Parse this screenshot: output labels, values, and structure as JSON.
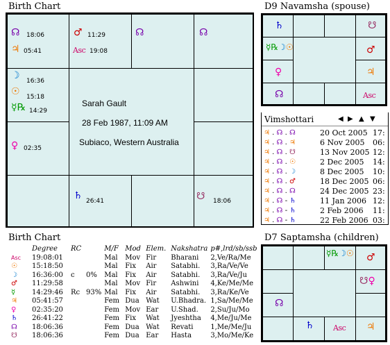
{
  "colors": {
    "mars": "#cc0000",
    "moon": "#0077cc",
    "venus": "#ee00aa",
    "mercury": "#009900",
    "jupiter": "#ee7700",
    "sun": "#ee7700",
    "saturn": "#0000cc",
    "rahu": "#7700aa",
    "ketu": "#993366",
    "asc": "#cc0066",
    "chart_fill": "#ddf0f0"
  },
  "birth_chart": {
    "title": "Birth Chart",
    "name": "Sarah Gault",
    "datetime": "28 Feb 1987,  11:09 AM",
    "place": "Subiaco, Western Australia",
    "houses": {
      "h12": [
        {
          "glyph": "☊",
          "deg": "18:06",
          "color": "rahu"
        },
        {
          "glyph": "♃",
          "deg": "05:41",
          "color": "jupiter"
        }
      ],
      "h1": [
        {
          "glyph": "♂",
          "deg": "11:29",
          "color": "mars"
        },
        {
          "glyph": "Asc",
          "deg": "19:08",
          "color": "asc"
        }
      ],
      "h11": [
        {
          "glyph": "☽",
          "deg": "16:36",
          "color": "moon"
        },
        {
          "glyph": "☉",
          "deg": "15:18",
          "color": "sun"
        },
        {
          "glyph": "☿℞",
          "deg": "14:29",
          "color": "mercury"
        }
      ],
      "h10": [
        {
          "glyph": "♀",
          "deg": "02:35",
          "color": "venus"
        }
      ],
      "h7": [
        {
          "glyph": "♄",
          "deg": "26:41",
          "color": "saturn"
        }
      ],
      "h6": [
        {
          "glyph": "☋",
          "deg": "18:06",
          "color": "ketu"
        }
      ],
      "h2": [
        {
          "glyph": "♉",
          "deg": "",
          "color": "rahu"
        }
      ]
    }
  },
  "d9": {
    "title": "D9 Navamsha  (spouse)",
    "houses": {
      "tl": [
        {
          "glyph": "♄",
          "color": "saturn"
        }
      ],
      "tr": [
        {
          "glyph": "☋",
          "color": "ketu"
        }
      ],
      "ml": [
        {
          "glyph": "☿℞☽☉",
          "color": "mercury"
        }
      ],
      "mr": [
        {
          "glyph": "♂",
          "color": "mars"
        }
      ],
      "l2": [
        {
          "glyph": "♀",
          "color": "venus"
        }
      ],
      "r2": [
        {
          "glyph": "♃",
          "color": "jupiter"
        }
      ],
      "bl": [
        {
          "glyph": "☊",
          "color": "rahu"
        }
      ],
      "br": [
        {
          "glyph": "Asc",
          "color": "asc"
        }
      ]
    }
  },
  "vimshottari": {
    "title": "Vimshottari",
    "rows": [
      {
        "glyphs": "♃ . ☊ . ☊",
        "date": "20 Oct 2005",
        "time": "17:"
      },
      {
        "glyphs": "♃ . ☊ . ♃",
        "date": "6 Nov 2005",
        "time": "06:"
      },
      {
        "glyphs": "♃ . ☊ . ☋",
        "date": "13 Nov 2005",
        "time": "12:"
      },
      {
        "glyphs": "♃ . ☊ . ☉",
        "date": "2 Dec 2005",
        "time": "14:"
      },
      {
        "glyphs": "♃ . ☊ . ☽",
        "date": "8 Dec 2005",
        "time": "10:"
      },
      {
        "glyphs": "♃ . ☊ . ♂",
        "date": "18 Dec 2005",
        "time": "06:"
      },
      {
        "glyphs": "♃ . ☊ . ☊",
        "date": "24 Dec 2005",
        "time": "23:"
      },
      {
        "glyphs": "♃ . ☊ - ♄",
        "date": "11 Jan 2006",
        "time": "12:"
      },
      {
        "glyphs": "♃ . ☊ - ♄",
        "date": "2 Feb 2006",
        "time": "11:"
      },
      {
        "glyphs": "♃ . ☊ - ♄",
        "date": "22 Feb 2006",
        "time": "03:"
      }
    ]
  },
  "d7": {
    "title": "D7 Saptamsha  (children)",
    "houses": {
      "tc": [
        {
          "glyph": "☿℞☽☉",
          "color": "mercury"
        }
      ],
      "tr": [
        {
          "glyph": "♂",
          "color": "mars"
        }
      ],
      "mr": [
        {
          "glyph": "☋♀",
          "color": "ketu"
        }
      ],
      "ml": [
        {
          "glyph": "☊",
          "color": "rahu"
        }
      ],
      "bc": [
        {
          "glyph": "♄",
          "color": "saturn"
        }
      ],
      "bc2": [
        {
          "glyph": "Asc",
          "color": "asc"
        }
      ],
      "br": [
        {
          "glyph": "♃",
          "color": "jupiter"
        }
      ]
    }
  },
  "planet_table": {
    "title": "Birth Chart",
    "headers": [
      "",
      "Degree",
      "RC",
      "",
      "M/F",
      "Mod",
      "Elem.",
      "Nakshatra",
      "p#,lrd/sb/ssb"
    ],
    "rows": [
      {
        "g": "Asc",
        "c": "asc",
        "deg": "19:08:01",
        "rc": "",
        "pct": "",
        "mf": "Mal",
        "mod": "Mov",
        "el": "Fir",
        "nak": "Bharani",
        "p": "2,Ve/Ra/Me"
      },
      {
        "g": "☉",
        "c": "sun",
        "deg": "15:18:50",
        "rc": "",
        "pct": "",
        "mf": "Mal",
        "mod": "Fix",
        "el": "Air",
        "nak": "Satabhi.",
        "p": "3,Ra/Ve/Ve"
      },
      {
        "g": "☽",
        "c": "moon",
        "deg": "16:36:00",
        "rc": "c",
        "pct": "0%",
        "mf": "Mal",
        "mod": "Fix",
        "el": "Air",
        "nak": "Satabhi.",
        "p": "3,Ra/Ve/Ju"
      },
      {
        "g": "♂",
        "c": "mars",
        "deg": "11:29:58",
        "rc": "",
        "pct": "",
        "mf": "Mal",
        "mod": "Mov",
        "el": "Fir",
        "nak": "Ashwini",
        "p": "4,Ke/Me/Me"
      },
      {
        "g": "☿",
        "c": "mercury",
        "deg": "14:29:46",
        "rc": "Rc",
        "pct": "93%",
        "mf": "Mal",
        "mod": "Fix",
        "el": "Air",
        "nak": "Satabhi.",
        "p": "3,Ra/Ke/Ve"
      },
      {
        "g": "♃",
        "c": "jupiter",
        "deg": "05:41:57",
        "rc": "",
        "pct": "",
        "mf": "Fem",
        "mod": "Dua",
        "el": "Wat",
        "nak": "U.Bhadra.",
        "p": "1,Sa/Me/Me"
      },
      {
        "g": "♀",
        "c": "venus",
        "deg": "02:35:20",
        "rc": "",
        "pct": "",
        "mf": "Fem",
        "mod": "Mov",
        "el": "Ear",
        "nak": "U.Shad.",
        "p": "2,Su/Ju/Mo"
      },
      {
        "g": "♄",
        "c": "saturn",
        "deg": "26:41:22",
        "rc": "",
        "pct": "",
        "mf": "Fem",
        "mod": "Fix",
        "el": "Wat",
        "nak": "Jyeshtha",
        "p": "4,Me/Ju/Me"
      },
      {
        "g": "☊",
        "c": "rahu",
        "deg": "18:06:36",
        "rc": "",
        "pct": "",
        "mf": "Fem",
        "mod": "Dua",
        "el": "Wat",
        "nak": "Revati",
        "p": "1,Me/Me/Ju"
      },
      {
        "g": "☋",
        "c": "ketu",
        "deg": "18:06:36",
        "rc": "",
        "pct": "",
        "mf": "Fem",
        "mod": "Dua",
        "el": "Ear",
        "nak": "Hasta",
        "p": "3,Mo/Me/Ke"
      }
    ]
  }
}
